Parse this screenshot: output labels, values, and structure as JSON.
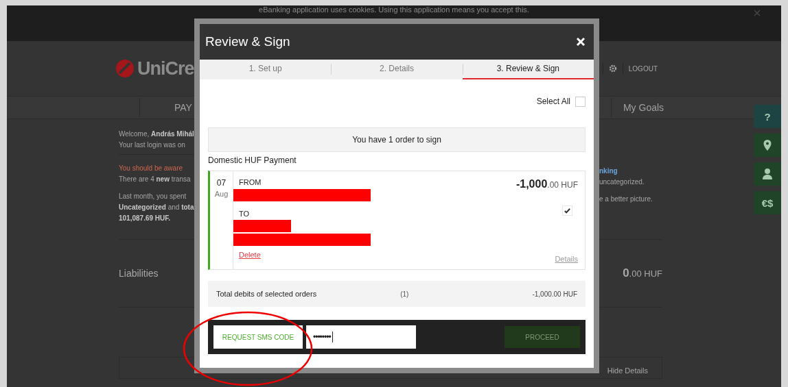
{
  "background": {
    "cookie_notice": "eBanking application uses cookies. Using this application means you accept this.",
    "logo_text": "UniCre",
    "logout": "LOGOUT",
    "nav": [
      "PAY",
      "My Goals"
    ],
    "left_lines": [
      {
        "kind": "plain",
        "text": "Welcome, **András Mihál**"
      },
      {
        "kind": "plain",
        "text": "Your last login was on"
      },
      {
        "kind": "rule"
      },
      {
        "kind": "alert",
        "text": "You should be aware"
      },
      {
        "kind": "plain",
        "text": "There are 4 **new** transa"
      },
      {
        "kind": "gap"
      },
      {
        "kind": "plain",
        "text": "Last month, you spent"
      },
      {
        "kind": "plain",
        "text": "**Uncategorized** and **tota**"
      },
      {
        "kind": "plain",
        "text": "**101,087.69 HUF.**"
      }
    ],
    "right_lines": [
      {
        "kind": "link",
        "text": "nking"
      },
      {
        "kind": "plain",
        "text": "uncategorized."
      },
      {
        "kind": "gap"
      },
      {
        "kind": "plain",
        "text": "e a better picture."
      }
    ],
    "liabilities": {
      "label": "Liabilities",
      "amount": "**0**.00 HUF"
    },
    "hide_details": "Hide Details"
  },
  "side_buttons": [
    {
      "kind": "text",
      "label": "?",
      "color": "#1d4443"
    },
    {
      "kind": "pin",
      "color": "#1f4428"
    },
    {
      "kind": "person",
      "color": "#1f4428"
    },
    {
      "kind": "text",
      "label": "€$",
      "color": "#1f4428"
    }
  ],
  "dialog": {
    "title": "Review & Sign",
    "tabs": [
      {
        "label": "1. Set up",
        "selected": false
      },
      {
        "label": "2. Details",
        "selected": false
      },
      {
        "label": "3. Review & Sign",
        "selected": true
      }
    ],
    "select_all": {
      "label": "Select All",
      "checked": false
    },
    "summary": "You have 1 order to sign",
    "group_title": "Domestic HUF Payment",
    "orders": [
      {
        "day": "07",
        "month": "Aug",
        "from_label": "FROM",
        "to_label": "TO",
        "amount": "**-1,000**.00 HUF",
        "checked": true,
        "delete": "Delete",
        "details": "Details"
      }
    ],
    "total": {
      "label": "Total debits of selected orders",
      "count": "(1)",
      "amount": "-1,000.00 HUF"
    },
    "sms_button": "REQUEST SMS CODE",
    "sms_code": "••••••••",
    "proceed": {
      "label": "PROCEED",
      "disabled": true
    }
  }
}
